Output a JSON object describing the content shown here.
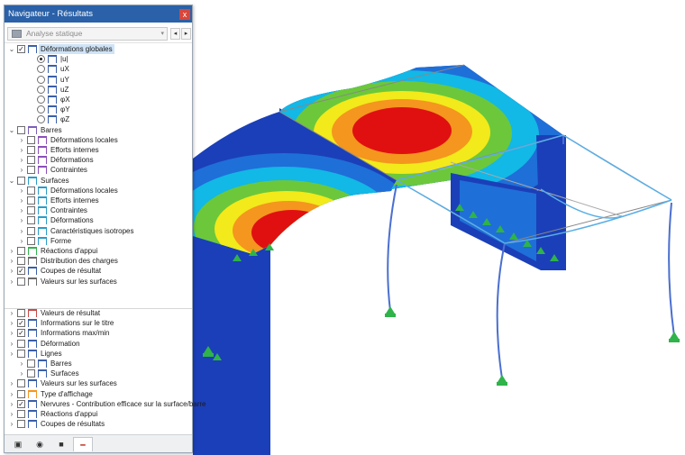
{
  "navigator": {
    "title": "Navigateur - Résultats",
    "close_glyph": "x",
    "combo": {
      "value": "Analyse statique",
      "icon": "analysis-icon"
    },
    "nav_prev": "◂",
    "nav_next": "▸"
  },
  "tree_top": [
    {
      "name": "tree-item-deformations-globales",
      "label": "Déformations globales",
      "exp": "v",
      "ctrl": "check",
      "checked": true,
      "icon": "deformation-icon",
      "selected": true
    },
    {
      "name": "tree-item-u-abs",
      "label": "|u|",
      "ctrl": "radio",
      "checked": true,
      "icon": "deformation-icon"
    },
    {
      "name": "tree-item-ux",
      "label": "uX",
      "ctrl": "radio",
      "checked": false,
      "icon": "deformation-icon"
    },
    {
      "name": "tree-item-uy",
      "label": "uY",
      "ctrl": "radio",
      "checked": false,
      "icon": "deformation-icon"
    },
    {
      "name": "tree-item-uz",
      "label": "uZ",
      "ctrl": "radio",
      "checked": false,
      "icon": "deformation-icon"
    },
    {
      "name": "tree-item-phix",
      "label": "φX",
      "ctrl": "radio",
      "checked": false,
      "icon": "deformation-icon"
    },
    {
      "name": "tree-item-phiy",
      "label": "φY",
      "ctrl": "radio",
      "checked": false,
      "icon": "deformation-icon"
    },
    {
      "name": "tree-item-phiz",
      "label": "φZ",
      "ctrl": "radio",
      "checked": false,
      "icon": "deformation-icon"
    },
    {
      "name": "tree-item-barres",
      "label": "Barres",
      "exp": "v",
      "ctrl": "check",
      "checked": false,
      "icon": "member-icon"
    },
    {
      "name": "tree-item-barres-def-locales",
      "label": "Déformations locales",
      "exp": ">",
      "ctrl": "check",
      "checked": false,
      "icon": "member-result-icon"
    },
    {
      "name": "tree-item-barres-efforts",
      "label": "Efforts internes",
      "exp": ">",
      "ctrl": "check",
      "checked": false,
      "icon": "member-result-icon"
    },
    {
      "name": "tree-item-barres-deformations",
      "label": "Déformations",
      "exp": ">",
      "ctrl": "check",
      "checked": false,
      "icon": "member-result-icon"
    },
    {
      "name": "tree-item-barres-contraintes",
      "label": "Contraintes",
      "exp": ">",
      "ctrl": "check",
      "checked": false,
      "icon": "member-result-icon"
    },
    {
      "name": "tree-item-surfaces",
      "label": "Surfaces",
      "exp": "v",
      "ctrl": "check",
      "checked": false,
      "icon": "surface-icon"
    },
    {
      "name": "tree-item-surfaces-def-locales",
      "label": "Déformations locales",
      "exp": ">",
      "ctrl": "check",
      "checked": false,
      "icon": "surface-result-icon"
    },
    {
      "name": "tree-item-surfaces-efforts",
      "label": "Efforts internes",
      "exp": ">",
      "ctrl": "check",
      "checked": false,
      "icon": "surface-result-icon"
    },
    {
      "name": "tree-item-surfaces-contraintes",
      "label": "Contraintes",
      "exp": ">",
      "ctrl": "check",
      "checked": false,
      "icon": "surface-result-icon"
    },
    {
      "name": "tree-item-surfaces-deformations",
      "label": "Déformations",
      "exp": ">",
      "ctrl": "check",
      "checked": false,
      "icon": "surface-result-icon"
    },
    {
      "name": "tree-item-surfaces-caracteristiques",
      "label": "Caractéristiques isotropes",
      "exp": ">",
      "ctrl": "check",
      "checked": false,
      "icon": "surface-result-icon"
    },
    {
      "name": "tree-item-surfaces-forme",
      "label": "Forme",
      "exp": ">",
      "ctrl": "check",
      "checked": false,
      "icon": "surface-result-icon"
    },
    {
      "name": "tree-item-reactions-appui",
      "label": "Réactions d'appui",
      "exp": ">",
      "ctrl": "check",
      "checked": false,
      "icon": "support-reaction-icon"
    },
    {
      "name": "tree-item-distribution-charges",
      "label": "Distribution des charges",
      "exp": ">",
      "ctrl": "check",
      "checked": false,
      "icon": "load-distribution-icon"
    },
    {
      "name": "tree-item-coupes-resultat",
      "label": "Coupes de résultat",
      "exp": ">",
      "ctrl": "check",
      "checked": true,
      "icon": "section-cut-icon"
    },
    {
      "name": "tree-item-valeurs-surfaces",
      "label": "Valeurs sur les surfaces",
      "exp": ">",
      "ctrl": "check",
      "checked": false,
      "icon": "surface-values-icon"
    }
  ],
  "tree_bottom": [
    {
      "name": "tree-item-valeurs-resultat",
      "label": "Valeurs de résultat",
      "exp": ">",
      "ctrl": "check",
      "checked": false,
      "icon": "result-values-icon"
    },
    {
      "name": "tree-item-infos-titre",
      "label": "Informations sur le titre",
      "exp": ">",
      "ctrl": "check",
      "checked": true,
      "icon": "display-icon"
    },
    {
      "name": "tree-item-infos-maxmin",
      "label": "Informations max/min",
      "exp": ">",
      "ctrl": "check",
      "checked": true,
      "icon": "display-icon"
    },
    {
      "name": "tree-item-deformation",
      "label": "Déformation",
      "exp": ">",
      "ctrl": "check",
      "checked": false,
      "icon": "display-icon"
    },
    {
      "name": "tree-item-lignes",
      "label": "Lignes",
      "exp": ">",
      "ctrl": "check",
      "checked": false,
      "icon": "display-icon"
    },
    {
      "name": "tree-item-barres-bottom",
      "label": "Barres",
      "exp": ">",
      "ctrl": "check",
      "checked": false,
      "icon": "display-icon"
    },
    {
      "name": "tree-item-surfaces-bottom",
      "label": "Surfaces",
      "exp": ">",
      "ctrl": "check",
      "checked": false,
      "icon": "display-icon"
    },
    {
      "name": "tree-item-valeurs-surfaces-bottom",
      "label": "Valeurs sur les surfaces",
      "exp": ">",
      "ctrl": "check",
      "checked": false,
      "icon": "display-icon"
    },
    {
      "name": "tree-item-type-affichage",
      "label": "Type d'affichage",
      "exp": ">",
      "ctrl": "check",
      "checked": false,
      "icon": "display-type-icon"
    },
    {
      "name": "tree-item-nervures",
      "label": "Nervures - Contribution efficace sur la surface/barre",
      "exp": ">",
      "ctrl": "check",
      "checked": true,
      "icon": "display-icon"
    },
    {
      "name": "tree-item-reactions-appui-bottom",
      "label": "Réactions d'appui",
      "exp": ">",
      "ctrl": "check",
      "checked": false,
      "icon": "display-icon"
    },
    {
      "name": "tree-item-coupes-resultats-bottom",
      "label": "Coupes de résultats",
      "exp": ">",
      "ctrl": "check",
      "checked": false,
      "icon": "display-icon"
    }
  ],
  "bottom_tabs": [
    {
      "name": "tab-data",
      "icon": "data-icon",
      "glyph": "▣",
      "active": false
    },
    {
      "name": "tab-view",
      "icon": "eye-icon",
      "glyph": "◉",
      "active": false
    },
    {
      "name": "tab-camera",
      "icon": "camera-icon",
      "glyph": "■",
      "active": false
    },
    {
      "name": "tab-results",
      "icon": "results-icon",
      "glyph": "━",
      "active": true
    }
  ],
  "colors": {
    "title_bar": "#2a61a8",
    "selection": "#cfe3f6",
    "contour_red": "#e01010",
    "contour_orange": "#f5961e",
    "contour_yellow": "#f2ea1a",
    "contour_green": "#6cc83a",
    "contour_cyan": "#12b8e6",
    "contour_blue": "#1f6fd8",
    "contour_dark_blue": "#1b3fb8",
    "support_green": "#2fb34a"
  }
}
